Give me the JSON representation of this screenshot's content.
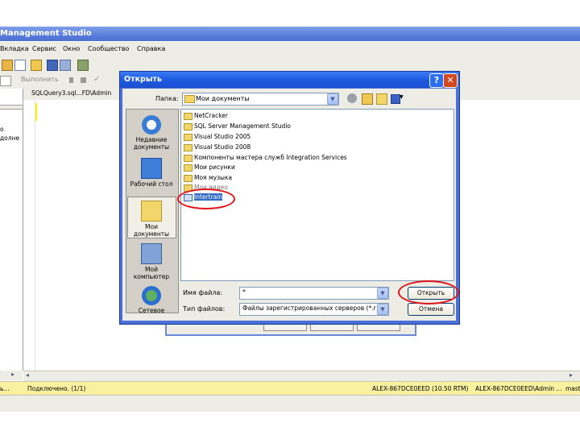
{
  "app": {
    "title": "Management Studio",
    "menu": [
      "Вкладка",
      "Сервис",
      "Окно",
      "Сообщество",
      "Справка"
    ],
    "toolbar2_text": "Выполнить",
    "left_panel_close": "✕",
    "left_panel_text": [
      "о",
      "долне"
    ],
    "editor_tab": "SQLQuery3.sql...FD\\Admin"
  },
  "statusbar": {
    "connection": "Подключено. (1/1)",
    "server": "ALEX-867DCE0EED (10.50 RTM)",
    "user": "ALEX-867DCE0EED\\Admin ...",
    "db": "mast",
    "left": "ь..."
  },
  "dialog": {
    "title": "Открыть",
    "help": "?",
    "close": "✕",
    "look_in_label": "Папка:",
    "look_in_value": "Мои документы",
    "places": [
      {
        "label": "Недавние документы",
        "icon": "recent-docs-icon"
      },
      {
        "label": "Рабочий стол",
        "icon": "desktop-icon"
      },
      {
        "label": "Мои документы",
        "icon": "my-documents-icon"
      },
      {
        "label": "Мой компьютер",
        "icon": "my-computer-icon"
      },
      {
        "label": "Сетевое",
        "icon": "network-icon"
      }
    ],
    "files": [
      "NetCracker",
      "SQL Server Management Studio",
      "Visual Studio 2005",
      "Visual Studio 2008",
      "Компоненты мастера служб Integration Services",
      "Мои рисунки",
      "Моя музыка",
      "Мои видео",
      "Intertrain"
    ],
    "selected_file": "Intertrain",
    "filename_label": "Имя файла:",
    "filename_value": "*",
    "filetype_label": "Тип файлов:",
    "filetype_value": "Файлы зарегистрированных серверов (*.re",
    "open_button": "Открыть",
    "cancel_button": "Отмена"
  },
  "colors": {
    "dialog_title": "#1c5ae0",
    "selection": "#316ac5",
    "highlight_circle": "#e0141a",
    "statusbar": "#f9f1a0"
  }
}
